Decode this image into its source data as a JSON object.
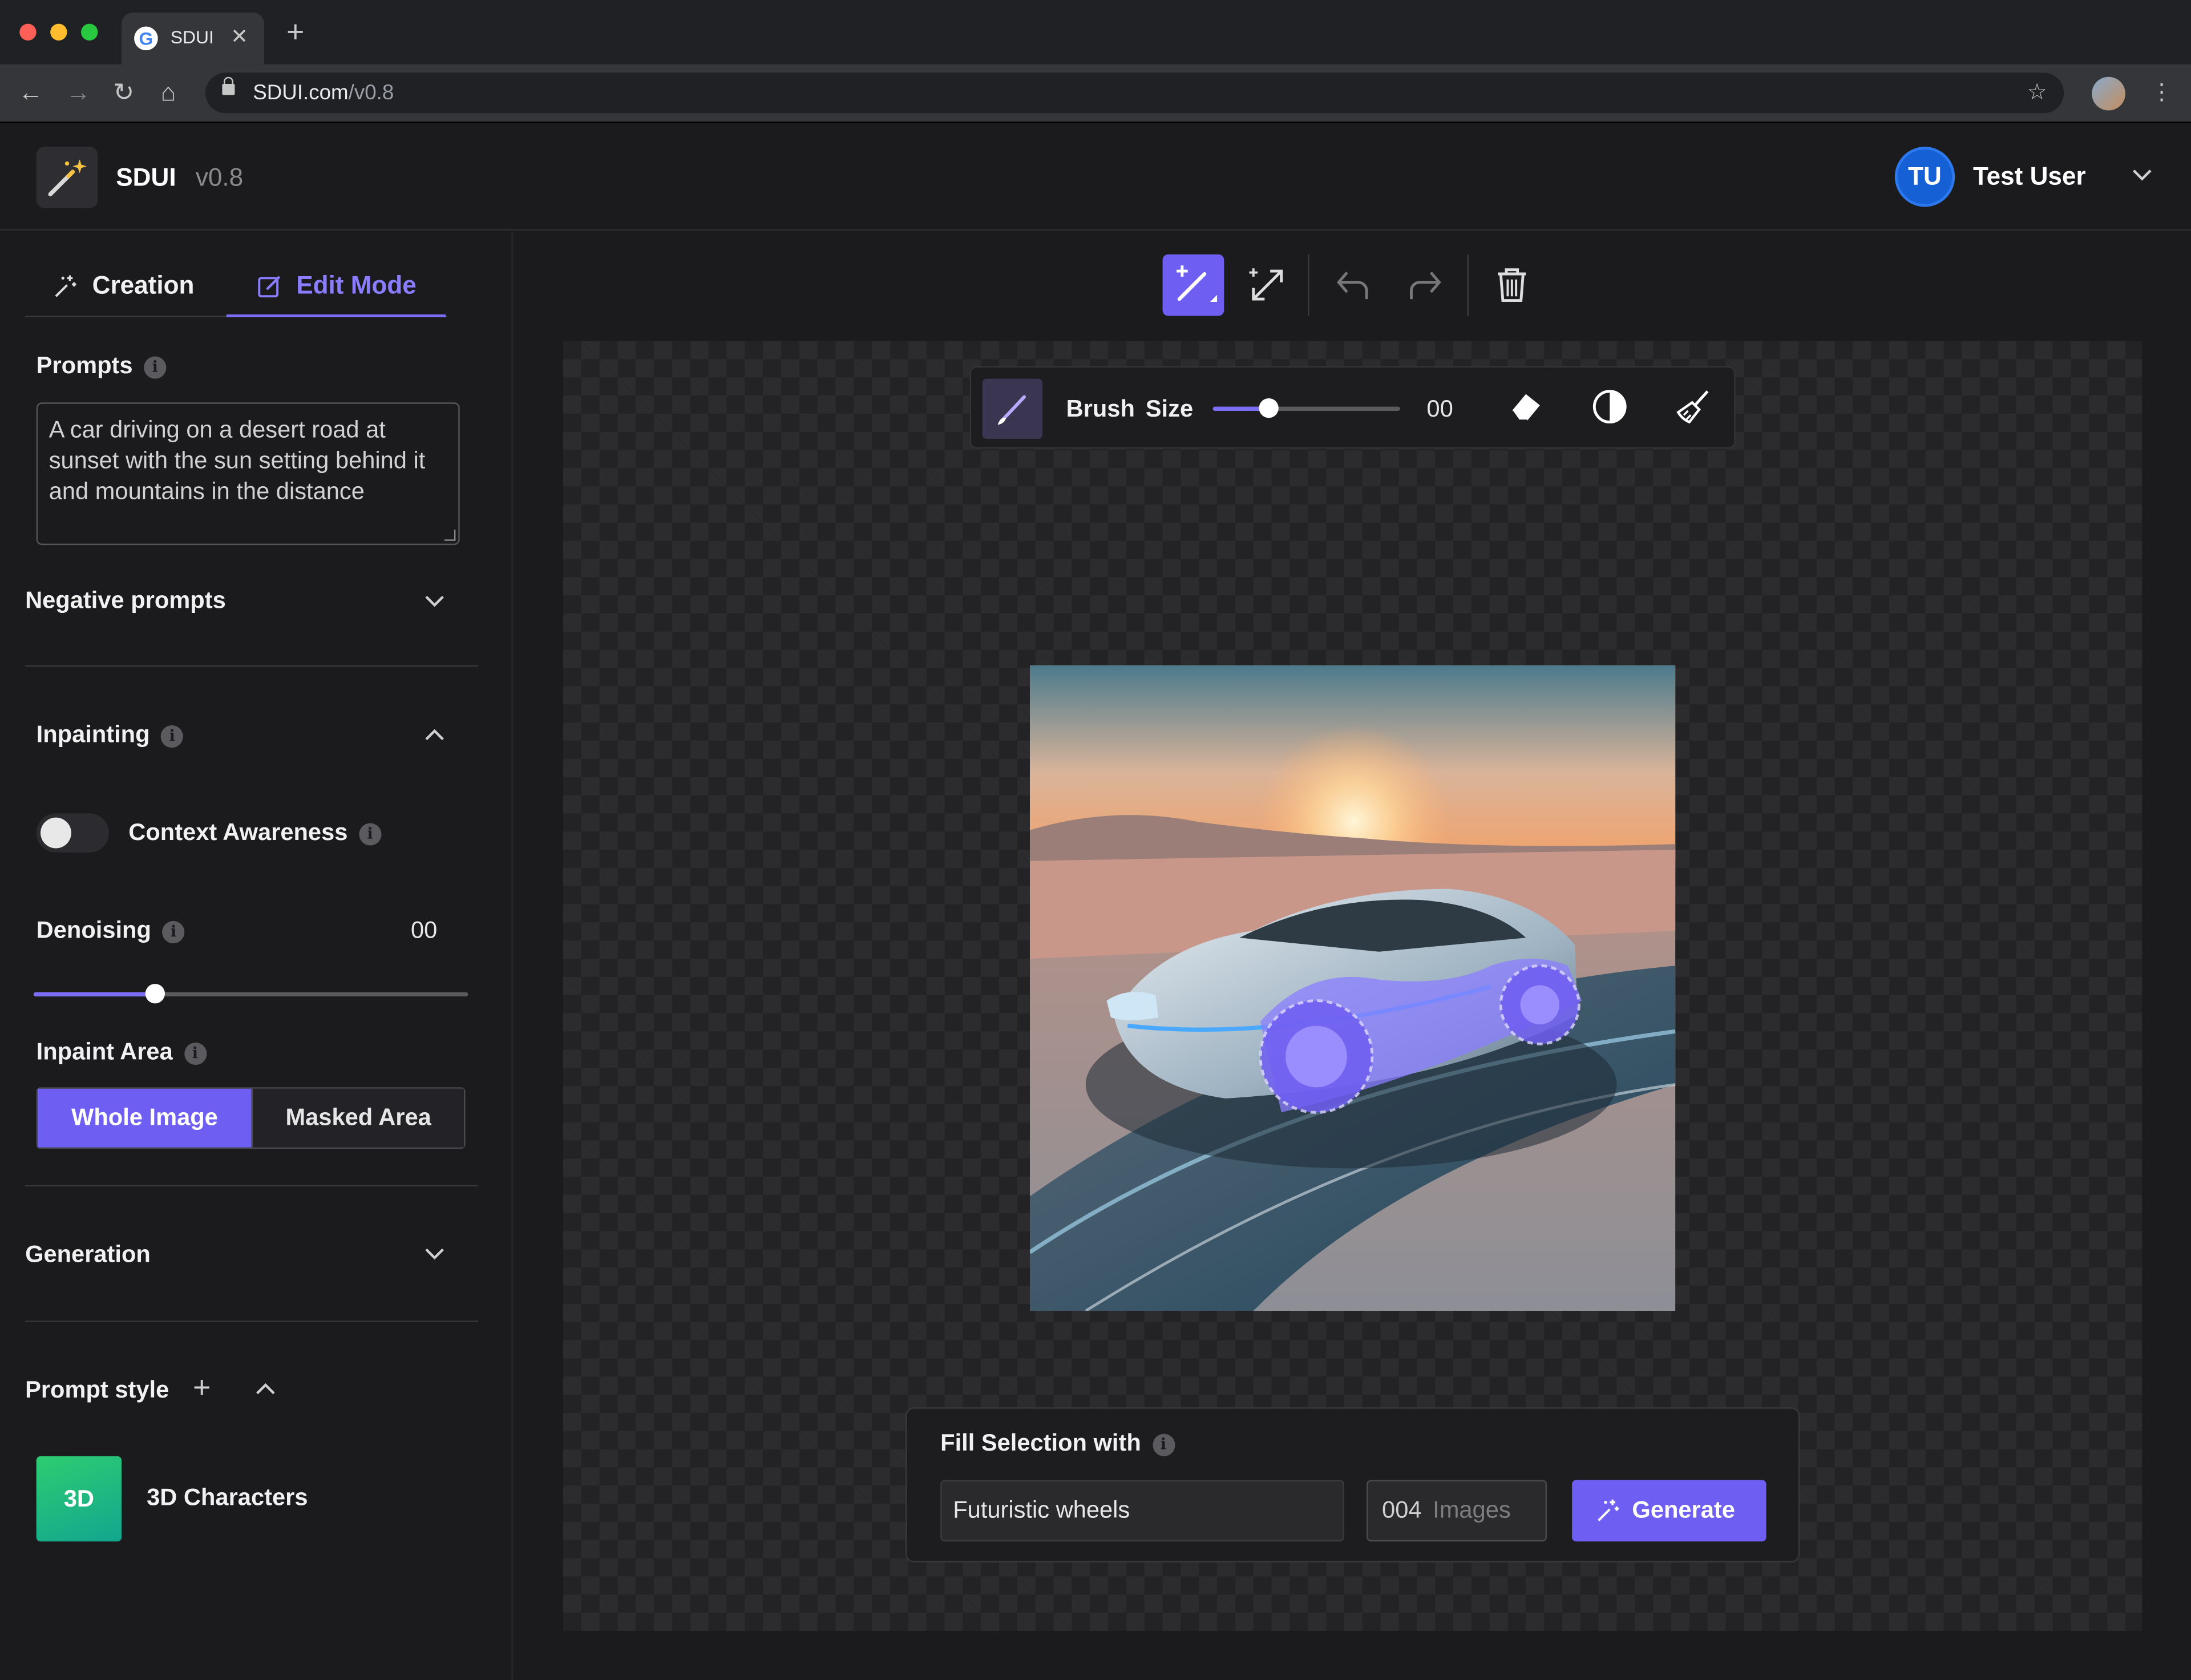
{
  "browser": {
    "tab_title": "SDUI",
    "url_host": "SDUI.com",
    "url_path": "/v0.8",
    "favicon": "G"
  },
  "app": {
    "name": "SDUI",
    "version": "v0.8",
    "logo_icon": "magic-wand-icon"
  },
  "user": {
    "initials": "TU",
    "name": "Test User"
  },
  "sidebar": {
    "tabs": [
      {
        "label": "Creation",
        "icon": "sparkle-icon",
        "active": false
      },
      {
        "label": "Edit Mode",
        "icon": "edit-icon",
        "active": true
      }
    ],
    "prompts_label": "Prompts",
    "prompt_text": "A car driving on a desert road at sunset with the sun setting behind it and mountains in the distance",
    "negative_label": "Negative prompts",
    "inpainting_label": "Inpainting",
    "context_label": "Context Awareness",
    "context_enabled": false,
    "denoising_label": "Denoising",
    "denoising_value": "00",
    "denoising_level": 0.28,
    "inpaint_area_label": "Inpaint Area",
    "inpaint_options": [
      "Whole Image",
      "Masked Area"
    ],
    "inpaint_selected": "Whole Image",
    "generation_label": "Generation",
    "prompt_style_label": "Prompt style",
    "style_badge": "3D",
    "style_name": "3D Characters"
  },
  "toolbar": {
    "icons": [
      "brush-add-icon",
      "expand-icon",
      "undo-icon",
      "redo-icon",
      "trash-icon"
    ]
  },
  "brush": {
    "label": "Brush Size",
    "value": "00",
    "level": 0.3,
    "tools": [
      "eraser-icon",
      "contrast-icon",
      "broom-icon"
    ]
  },
  "fill": {
    "title": "Fill Selection with",
    "input_value": "Futuristic wheels",
    "count": "004",
    "count_unit": "Images",
    "generate_label": "Generate"
  },
  "colors": {
    "accent": "#6e5ef2",
    "background": "#1b1b1d",
    "avatar": "#1660d6",
    "style_badge": "#2ecc71"
  }
}
